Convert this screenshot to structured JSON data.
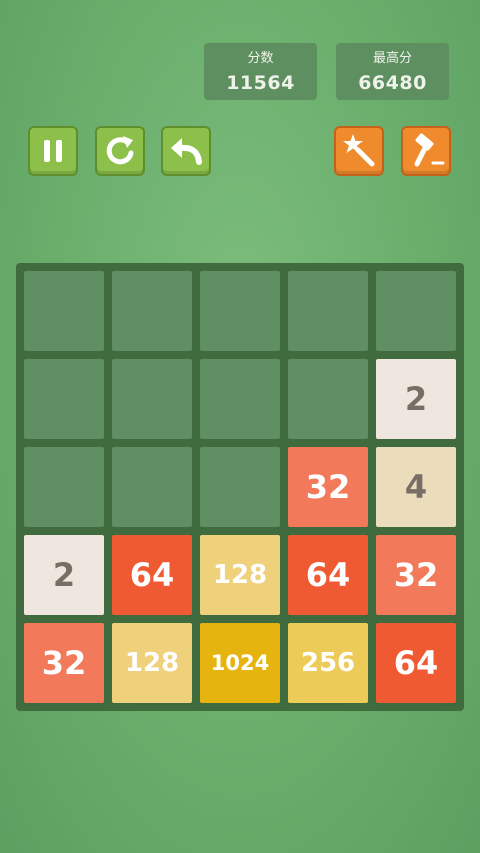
{
  "score": {
    "label": "分数",
    "value": "11564"
  },
  "best": {
    "label": "最高分",
    "value": "66480"
  },
  "toolbar": {
    "pause_icon": "pause-icon",
    "restart_icon": "restart-icon",
    "undo_icon": "undo-icon",
    "magic_icon": "magic-wand-icon",
    "hammer_icon": "hammer-icon",
    "colors": {
      "green_button": "#8cc04a",
      "orange_button": "#f08b2d"
    }
  },
  "board": {
    "size": 5,
    "rows": [
      [
        0,
        0,
        0,
        0,
        0
      ],
      [
        0,
        0,
        0,
        0,
        2
      ],
      [
        0,
        0,
        0,
        32,
        4
      ],
      [
        2,
        64,
        128,
        64,
        32
      ],
      [
        32,
        128,
        1024,
        256,
        64
      ]
    ]
  }
}
